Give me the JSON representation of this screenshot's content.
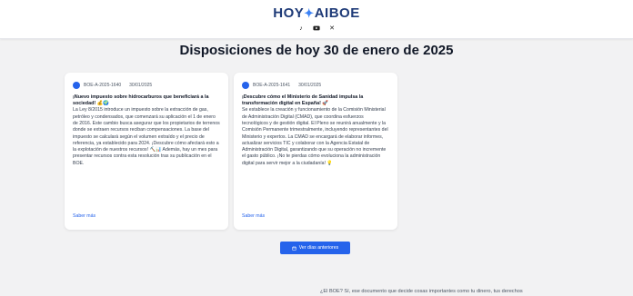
{
  "header": {
    "logo_left": "HOY",
    "logo_plus": "✦",
    "logo_right": "AIBOE",
    "socials": [
      {
        "icon": "tiktok-icon",
        "glyph": "♪"
      },
      {
        "icon": "youtube-icon",
        "glyph": ""
      },
      {
        "icon": "x-icon",
        "glyph": "✕"
      }
    ]
  },
  "main": {
    "title": "Disposiciones de hoy 30 de enero de 2025"
  },
  "cards": [
    {
      "id": "BOE-A-2025-1640",
      "date": "30/01/2025",
      "title": "¡Nuevo impuesto sobre hidrocarburos que beneficiará a la sociedad! 💰🌍",
      "body": "La Ley 8/2015 introduce un impuesto sobre la extracción de gas, petróleo y condensados, que comenzará su aplicación el 1 de enero de 2016. Este cambio busca asegurar que los propietarios de terrenos donde se extraen recursos reciban compensaciones. La base del impuesto se calculará según el volumen extraído y el precio de referencia, ya establecido para 2024. ¡Descubre cómo afectará esto a la explotación de nuestros recursos! ⛏️📊 Además, hay un mes para presentar recursos contra esta resolución tras su publicación en el BOE.",
      "more": "Saber más"
    },
    {
      "id": "BOE-A-2025-1641",
      "date": "30/01/2025",
      "title": "¡Descubre cómo el Ministerio de Sanidad impulsa la transformación digital en España! 🚀",
      "body": "Se establece la creación y funcionamiento de la Comisión Ministerial de Administración Digital (CMAD), que coordina esfuerzos tecnológicos y de gestión digital. El Pleno se reunirá anualmente y la Comisión Permanente trimestralmente, incluyendo representantes del Ministerio y expertos. La CMAD se encargará de elaborar informes, actualizar servicios TIC y colaborar con la Agencia Estatal de Administración Digital, garantizando que su operación no incremente el gasto público. ¡No te pierdas cómo evoluciona la administración digital para servir mejor a la ciudadanía! 💡",
      "more": "Saber más"
    }
  ],
  "actions": {
    "previous_days": "Ver días anteriores"
  },
  "footer": {
    "text": "¿El BOE? Sí, ese documento que decide cosas importantes como tu dinero, tus derechos"
  },
  "colors": {
    "accent": "#2563eb",
    "background": "#f2f2f3",
    "logo": "#1f3b78"
  }
}
